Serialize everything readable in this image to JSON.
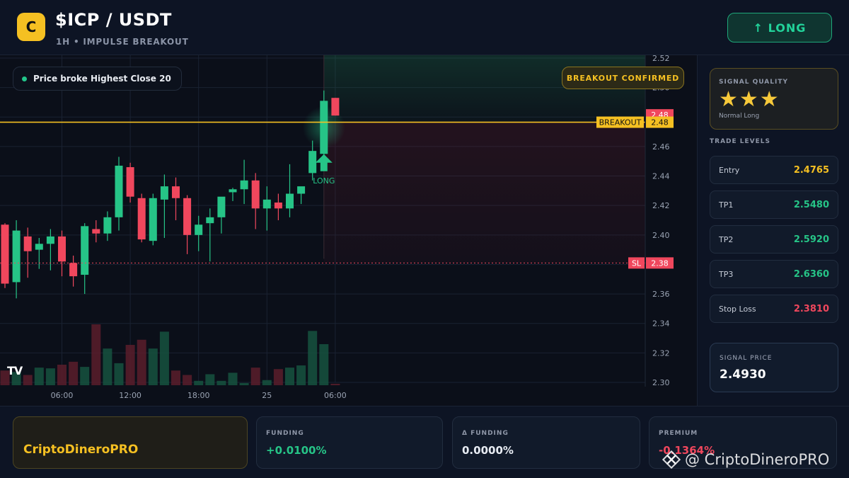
{
  "header": {
    "logo_letter": "C",
    "pair": "$ICP / USDT",
    "subtitle": "1H • IMPULSE BREAKOUT",
    "signal_button": "↑ LONG"
  },
  "chart_overlay": {
    "note": "Price broke Highest Close 20",
    "badge": "BREAKOUT CONFIRMED",
    "tv_logo": "TV",
    "long_marker_label": "LONG",
    "breakout_tag": "BREAKOUT",
    "sl_tag": "SL"
  },
  "chart_data": {
    "type": "candlestick",
    "y_ticks": [
      "2.52",
      "2.50",
      "2.48",
      "2.46",
      "2.44",
      "2.42",
      "2.40",
      "2.38",
      "2.36",
      "2.34",
      "2.32",
      "2.30"
    ],
    "ylim": [
      2.3,
      2.52
    ],
    "x_ticks": [
      "06:00",
      "12:00",
      "18:00",
      "25",
      "06:00"
    ],
    "x_tick_index": [
      5,
      11,
      17,
      23,
      29
    ],
    "breakout_level": 2.4765,
    "breakout_label_value": "2.48",
    "current_price_label": "2.48",
    "stop_loss_level": 2.381,
    "stop_loss_label_value": "2.38",
    "long_signal_index": 28,
    "candles": [
      {
        "o": 2.407,
        "h": 2.408,
        "l": 2.364,
        "c": 2.367
      },
      {
        "o": 2.368,
        "h": 2.41,
        "l": 2.357,
        "c": 2.403
      },
      {
        "o": 2.399,
        "h": 2.405,
        "l": 2.371,
        "c": 2.389
      },
      {
        "o": 2.39,
        "h": 2.398,
        "l": 2.377,
        "c": 2.394
      },
      {
        "o": 2.394,
        "h": 2.404,
        "l": 2.376,
        "c": 2.399
      },
      {
        "o": 2.399,
        "h": 2.403,
        "l": 2.372,
        "c": 2.382
      },
      {
        "o": 2.381,
        "h": 2.386,
        "l": 2.365,
        "c": 2.372
      },
      {
        "o": 2.373,
        "h": 2.408,
        "l": 2.36,
        "c": 2.406
      },
      {
        "o": 2.404,
        "h": 2.41,
        "l": 2.395,
        "c": 2.401
      },
      {
        "o": 2.401,
        "h": 2.416,
        "l": 2.396,
        "c": 2.412
      },
      {
        "o": 2.412,
        "h": 2.453,
        "l": 2.403,
        "c": 2.447
      },
      {
        "o": 2.446,
        "h": 2.449,
        "l": 2.422,
        "c": 2.426
      },
      {
        "o": 2.425,
        "h": 2.428,
        "l": 2.395,
        "c": 2.397
      },
      {
        "o": 2.396,
        "h": 2.428,
        "l": 2.393,
        "c": 2.425
      },
      {
        "o": 2.424,
        "h": 2.441,
        "l": 2.398,
        "c": 2.433
      },
      {
        "o": 2.433,
        "h": 2.439,
        "l": 2.41,
        "c": 2.425
      },
      {
        "o": 2.425,
        "h": 2.427,
        "l": 2.387,
        "c": 2.4
      },
      {
        "o": 2.4,
        "h": 2.413,
        "l": 2.389,
        "c": 2.407
      },
      {
        "o": 2.408,
        "h": 2.418,
        "l": 2.382,
        "c": 2.412
      },
      {
        "o": 2.412,
        "h": 2.425,
        "l": 2.401,
        "c": 2.426
      },
      {
        "o": 2.429,
        "h": 2.432,
        "l": 2.423,
        "c": 2.431
      },
      {
        "o": 2.431,
        "h": 2.451,
        "l": 2.421,
        "c": 2.437
      },
      {
        "o": 2.437,
        "h": 2.442,
        "l": 2.404,
        "c": 2.418
      },
      {
        "o": 2.418,
        "h": 2.433,
        "l": 2.403,
        "c": 2.424
      },
      {
        "o": 2.422,
        "h": 2.428,
        "l": 2.41,
        "c": 2.418
      },
      {
        "o": 2.418,
        "h": 2.448,
        "l": 2.412,
        "c": 2.428
      },
      {
        "o": 2.428,
        "h": 2.431,
        "l": 2.421,
        "c": 2.433
      },
      {
        "o": 2.442,
        "h": 2.464,
        "l": 2.437,
        "c": 2.457
      },
      {
        "o": 2.455,
        "h": 2.498,
        "l": 2.448,
        "c": 2.491
      },
      {
        "o": 2.493,
        "h": 2.493,
        "l": 2.481,
        "c": 2.481
      }
    ],
    "volumes": [
      0.2,
      0.18,
      0.14,
      0.24,
      0.23,
      0.28,
      0.32,
      0.25,
      0.83,
      0.5,
      0.3,
      0.55,
      0.62,
      0.5,
      0.73,
      0.2,
      0.14,
      0.06,
      0.15,
      0.06,
      0.17,
      0.03,
      0.24,
      0.07,
      0.22,
      0.24,
      0.27,
      0.74,
      0.56,
      0.02
    ],
    "volume_max": 0.83
  },
  "colors": {
    "bull": "#26c487",
    "bear": "#f0475d",
    "gold": "#f5c022",
    "grid": "#1a2232",
    "axis_text": "#9aa3b3"
  },
  "side_panel": {
    "quality_label": "SIGNAL QUALITY",
    "stars": "★★★",
    "quality_sub": "Normal Long",
    "levels_title": "TRADE LEVELS",
    "levels": [
      {
        "name": "Entry",
        "value": "2.4765",
        "color": "#f5c022"
      },
      {
        "name": "TP1",
        "value": "2.5480",
        "color": "#26c487"
      },
      {
        "name": "TP2",
        "value": "2.5920",
        "color": "#26c487"
      },
      {
        "name": "TP3",
        "value": "2.6360",
        "color": "#26c487"
      },
      {
        "name": "Stop Loss",
        "value": "2.3810",
        "color": "#f0475d"
      }
    ],
    "signal_price_label": "SIGNAL PRICE",
    "signal_price": "2.4930"
  },
  "bottom": {
    "brand": "CriptoDineroPRO",
    "funding_label": "FUNDING",
    "funding_value": "+0.0100%",
    "delta_funding_label": "Δ FUNDING",
    "delta_funding_value": "0.0000%",
    "premium_label": "PREMIUM",
    "premium_value": "-0.1364%",
    "watermark": "@ CriptoDineroPRO"
  }
}
